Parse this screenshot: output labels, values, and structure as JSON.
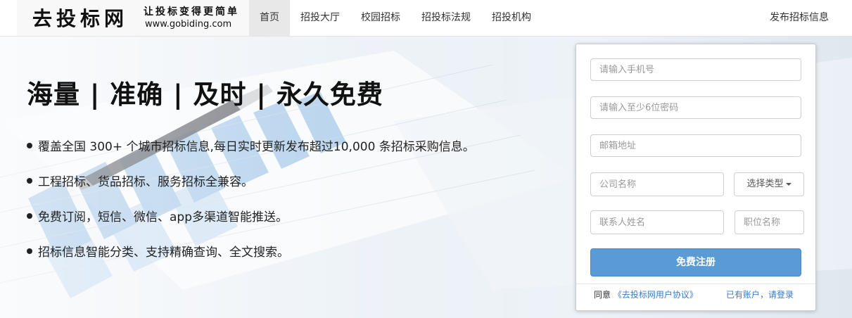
{
  "header": {
    "logo_title": "去投标网",
    "logo_slogan": "让投标变得更简单",
    "logo_url": "www.gobiding.com",
    "nav": [
      "首页",
      "招投大厅",
      "校园招标",
      "招投标法规",
      "招投机构"
    ],
    "publish": "发布招标信息"
  },
  "hero": {
    "headline": "海量 | 准确 | 及时 | 永久免费",
    "features": [
      "覆盖全国 300+ 个城市招标信息,每日实时更新发布超过10,000 条招标采购信息。",
      "工程招标、货品招标、服务招标全兼容。",
      "免费订阅，短信、微信、app多渠道智能推送。",
      "招标信息智能分类、支持精确查询、全文搜索。"
    ]
  },
  "register": {
    "phone_placeholder": "请输入手机号",
    "password_placeholder": "请输入至少6位密码",
    "email_placeholder": "邮箱地址",
    "company_placeholder": "公司名称",
    "type_select": "选择类型",
    "contact_placeholder": "联系人姓名",
    "position_placeholder": "职位名称",
    "submit": "免费注册",
    "agree_prefix": "同意",
    "agreement_link": "《去投标网用户协议》",
    "login_link": "已有账户，请登录"
  },
  "colors": {
    "primary": "#5b9bd5",
    "link": "#3a7bc8"
  }
}
